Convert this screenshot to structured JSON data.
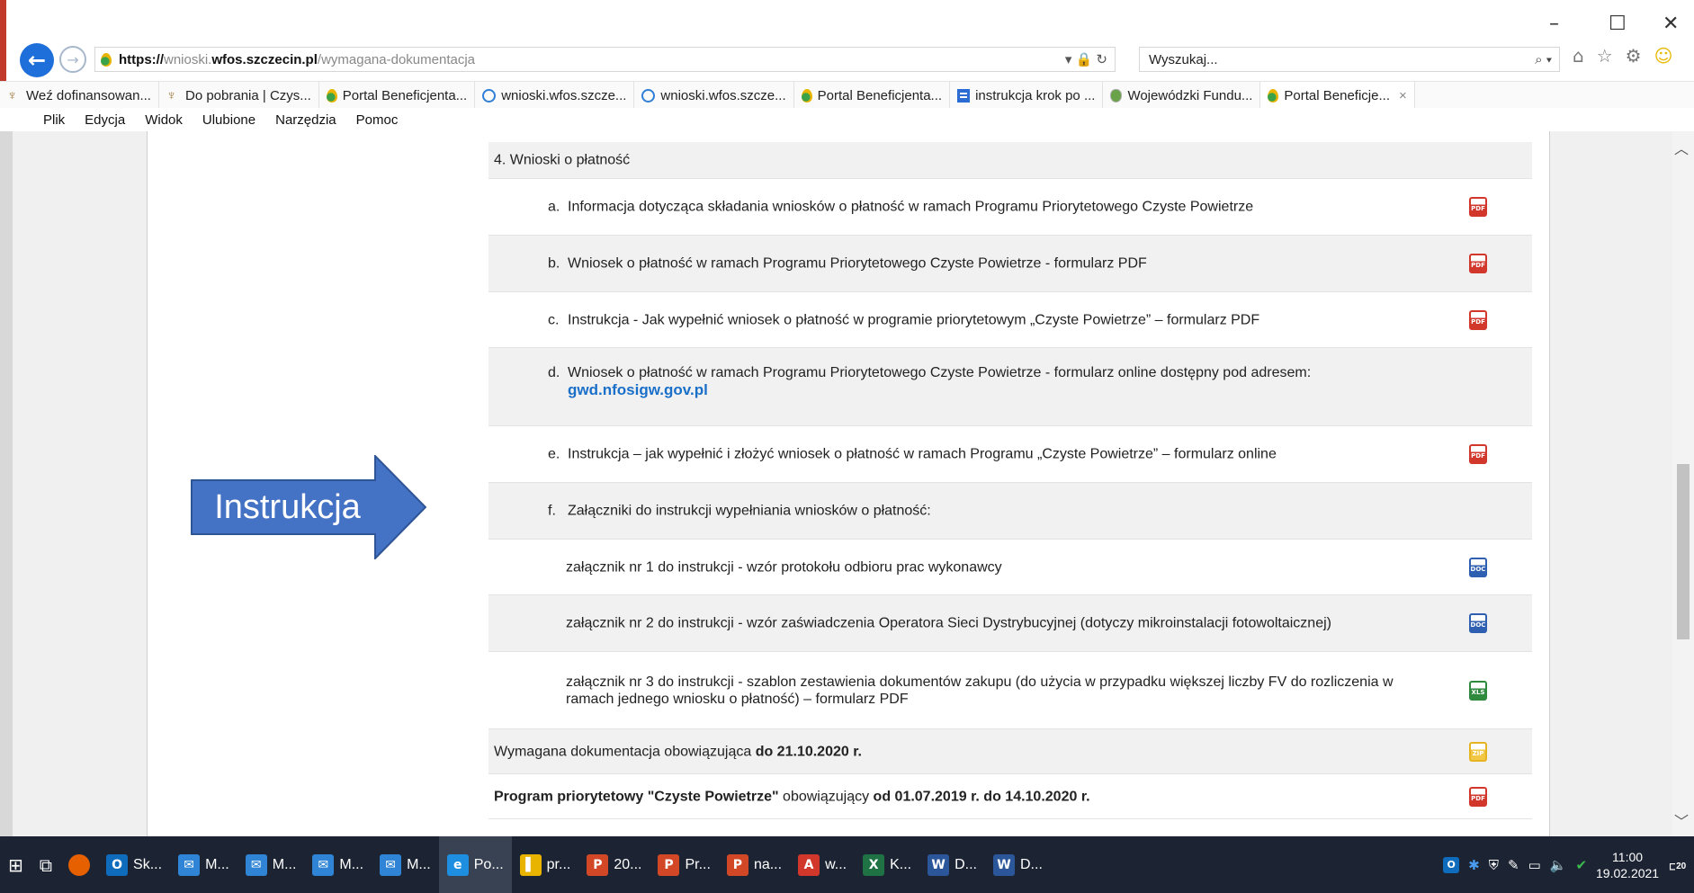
{
  "browser": {
    "address": {
      "url_scheme": "https://",
      "url_host_a": "wnioski.",
      "url_host_b": "wfos.szczecin.pl",
      "url_path": "/wymagana-dokumentacja",
      "controls": "▾ 🔒 ↻"
    },
    "search_placeholder": "Wyszukaj...",
    "search_controls": "⌕ ▾",
    "window_controls": {
      "minimize": "–",
      "maximize": "☐",
      "close": "✕"
    },
    "tabs": [
      {
        "label": "Weź dofinansowan...",
        "icon": "eagle-icon"
      },
      {
        "label": "Do pobrania | Czys...",
        "icon": "eagle-icon"
      },
      {
        "label": "Portal Beneficjenta...",
        "icon": "drop-icon"
      },
      {
        "label": "wnioski.wfos.szcze...",
        "icon": "ie-icon"
      },
      {
        "label": "wnioski.wfos.szcze...",
        "icon": "ie-icon"
      },
      {
        "label": "Portal Beneficjenta...",
        "icon": "drop-icon"
      },
      {
        "label": "instrukcja krok po ...",
        "icon": "doc-icon"
      },
      {
        "label": "Wojewódzki Fundu...",
        "icon": "gov-icon"
      },
      {
        "label": "Portal Beneficje...",
        "icon": "drop-icon",
        "active": true
      }
    ],
    "tab_close": "×",
    "menu": [
      "Plik",
      "Edycja",
      "Widok",
      "Ulubione",
      "Narzędzia",
      "Pomoc"
    ]
  },
  "document": {
    "section_header": "4.   Wnioski o płatność",
    "items": [
      {
        "letter": "a.",
        "text": "Informacja dotycząca składania wniosków o płatność w ramach Programu Priorytetowego Czyste Powietrze",
        "file": "pdf"
      },
      {
        "letter": "b.",
        "text": "Wniosek o płatność w ramach Programu Priorytetowego Czyste Powietrze - formularz PDF",
        "file": "pdf"
      },
      {
        "letter": "c.",
        "text": "Instrukcja - Jak wypełnić wniosek o płatność w programie priorytetowym „Czyste Powietrze” – formularz PDF",
        "file": "pdf"
      },
      {
        "letter": "d.",
        "text": "Wniosek o płatność w ramach Programu Priorytetowego Czyste Powietrze - formularz online dostępny pod adresem:",
        "link": "gwd.nfosigw.gov.pl",
        "file": null
      },
      {
        "letter": "e.",
        "text": "Instrukcja – jak wypełnić i złożyć wniosek o płatność w ramach Programu „Czyste Powietrze” – formularz online",
        "file": "pdf"
      },
      {
        "letter": "f.",
        "text": "Załączniki do instrukcji wypełniania wniosków o płatność:",
        "file": null
      }
    ],
    "attachments": [
      {
        "text": "załącznik nr 1 do instrukcji - wzór protokołu odbioru prac wykonawcy",
        "file": "doc"
      },
      {
        "text": "załącznik nr 2 do instrukcji - wzór zaświadczenia Operatora Sieci Dystrybucyjnej (dotyczy mikroinstalacji fotowoltaicznej)",
        "file": "doc"
      },
      {
        "text": "załącznik nr 3 do instrukcji - szablon zestawienia dokumentów zakupu (do użycia w przypadku większej liczby FV do rozliczenia w ramach jednego wniosku o płatność) – formularz PDF",
        "file": "xls"
      }
    ],
    "archive_1": {
      "prefix": "Wymagana dokumentacja obowiązująca ",
      "bold": "do 21.10.2020 r.",
      "file": "zip"
    },
    "archive_2": {
      "bold_a": "Program priorytetowy \"Czyste Powietrze\"",
      "mid": " obowiązujący ",
      "bold_b": "od 01.07.2019 r. do 14.10.2020 r.",
      "file": "pdf"
    },
    "file_labels": {
      "pdf": "PDF",
      "doc": "DOC",
      "xls": "XLS",
      "zip": "ZIP"
    }
  },
  "overlay": {
    "arrow_label": "Instrukcja",
    "arrow_color": "#4472c4",
    "arrow_border": "#2f5597"
  },
  "taskbar": {
    "items": [
      {
        "label": "Sk...",
        "icon": "outlook-icon",
        "color": "#0f6cbd",
        "glyph": "O"
      },
      {
        "label": "M...",
        "icon": "mail-icon",
        "color": "#2f84d6",
        "glyph": "✉"
      },
      {
        "label": "M...",
        "icon": "mail-icon",
        "color": "#2f84d6",
        "glyph": "✉"
      },
      {
        "label": "M...",
        "icon": "mail-icon",
        "color": "#2f84d6",
        "glyph": "✉"
      },
      {
        "label": "M...",
        "icon": "mail-icon",
        "color": "#2f84d6",
        "glyph": "✉"
      },
      {
        "label": "Po...",
        "icon": "ie-icon",
        "color": "#1e8fe0",
        "glyph": "e",
        "active": true
      },
      {
        "label": "pr...",
        "icon": "folder-icon",
        "color": "#e8b400",
        "glyph": "▌"
      },
      {
        "label": "20...",
        "icon": "powerpoint-icon",
        "color": "#d24726",
        "glyph": "P"
      },
      {
        "label": "Pr...",
        "icon": "powerpoint-icon",
        "color": "#d24726",
        "glyph": "P"
      },
      {
        "label": "na...",
        "icon": "powerpoint-icon",
        "color": "#d24726",
        "glyph": "P"
      },
      {
        "label": "w...",
        "icon": "pdf-icon",
        "color": "#d2372c",
        "glyph": "A"
      },
      {
        "label": "K...",
        "icon": "excel-icon",
        "color": "#1f7244",
        "glyph": "X"
      },
      {
        "label": "D...",
        "icon": "word-icon",
        "color": "#2b579a",
        "glyph": "W"
      },
      {
        "label": "D...",
        "icon": "word-icon",
        "color": "#2b579a",
        "glyph": "W"
      }
    ],
    "tray": {
      "time": "11:00",
      "date": "19.02.2021",
      "notification_count": "20"
    }
  }
}
